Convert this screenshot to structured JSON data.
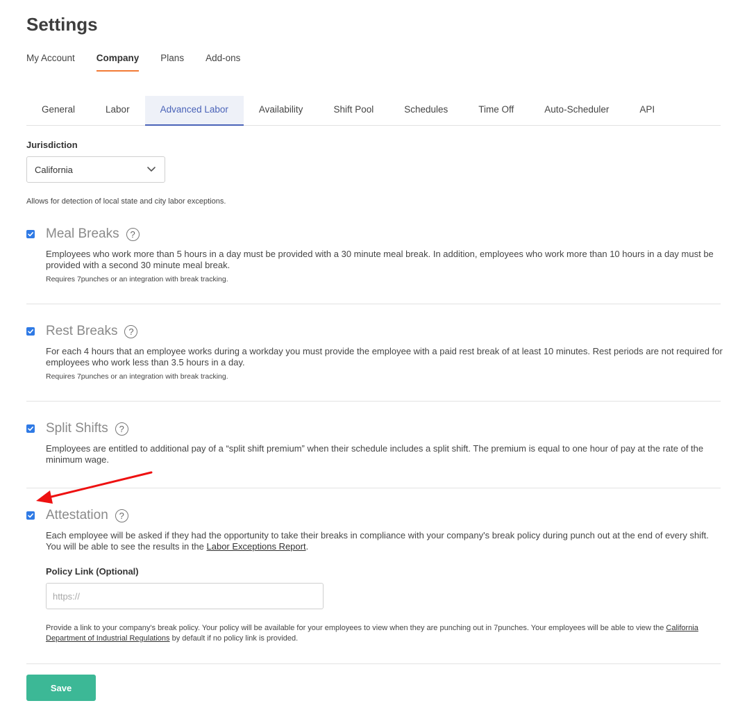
{
  "page": {
    "title": "Settings"
  },
  "top_tabs": [
    {
      "label": "My Account"
    },
    {
      "label": "Company",
      "active": true
    },
    {
      "label": "Plans"
    },
    {
      "label": "Add-ons"
    }
  ],
  "sub_tabs": [
    {
      "label": "General"
    },
    {
      "label": "Labor"
    },
    {
      "label": "Advanced Labor",
      "active": true
    },
    {
      "label": "Availability"
    },
    {
      "label": "Shift Pool"
    },
    {
      "label": "Schedules"
    },
    {
      "label": "Time Off"
    },
    {
      "label": "Auto-Scheduler"
    },
    {
      "label": "API"
    }
  ],
  "jurisdiction": {
    "label": "Jurisdiction",
    "value": "California",
    "help": "Allows for detection of local state and city labor exceptions."
  },
  "sections": {
    "meal_breaks": {
      "title": "Meal Breaks",
      "checked": true,
      "description": "Employees who work more than 5 hours in a day must be provided with a 30 minute meal break. In addition, employees who work more than 10 hours in a day must be provided with a second 30 minute meal break.",
      "note": "Requires 7punches or an integration with break tracking."
    },
    "rest_breaks": {
      "title": "Rest Breaks",
      "checked": true,
      "description": "For each 4 hours that an employee works during a workday you must provide the employee with a paid rest break of at least 10 minutes. Rest periods are not required for employees who work less than 3.5 hours in a day.",
      "note": "Requires 7punches or an integration with break tracking."
    },
    "split_shifts": {
      "title": "Split Shifts",
      "checked": true,
      "description": "Employees are entitled to additional pay of a “split shift premium” when their schedule includes a split shift. The premium is equal to one hour of pay at the rate of the minimum wage."
    },
    "attestation": {
      "title": "Attestation",
      "checked": true,
      "description_before": "Each employee will be asked if they had the opportunity to take their breaks in compliance with your company's break policy during punch out at the end of every shift. You will be able to see the results in the ",
      "description_link": "Labor Exceptions Report",
      "description_after": ".",
      "policy_label": "Policy Link (Optional)",
      "policy_placeholder": "https://",
      "policy_help_before": "Provide a link to your company's break policy. Your policy will be available for your employees to view when they are punching out in 7punches. Your employees will be able to view the ",
      "policy_help_link": "California Department of Industrial Regulations",
      "policy_help_after": " by default if no policy link is provided."
    }
  },
  "help_icon_glyph": "?",
  "save_label": "Save",
  "colors": {
    "accent_tab_underline": "#f27b35",
    "active_subtab": "#4a63b8",
    "checkbox": "#2f7ae5",
    "save_button": "#3cb896",
    "annotation_arrow": "#ee1111"
  }
}
